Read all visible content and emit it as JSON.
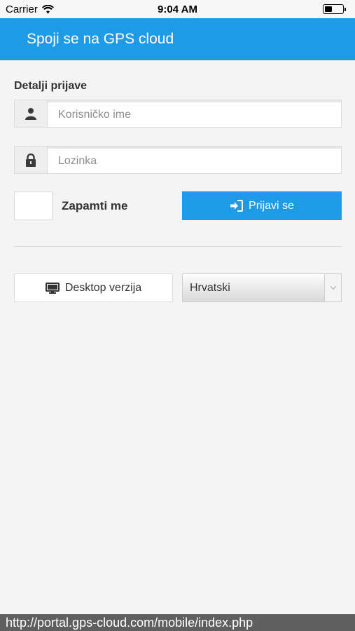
{
  "status_bar": {
    "carrier": "Carrier",
    "time": "9:04 AM"
  },
  "header": {
    "title": "Spoji se na GPS cloud"
  },
  "login": {
    "section_title": "Detalji prijave",
    "username_placeholder": "Korisničko ime",
    "password_placeholder": "Lozinka",
    "remember_label": "Zapamti me",
    "login_button": "Prijavi se"
  },
  "footer": {
    "desktop_button": "Desktop verzija",
    "language_selected": "Hrvatski"
  },
  "url": "http://portal.gps-cloud.com/mobile/index.php",
  "colors": {
    "accent": "#1e9be6",
    "background": "#f4f4f4"
  },
  "icons": [
    "wifi-icon",
    "battery-icon",
    "user-icon",
    "lock-icon",
    "sign-in-icon",
    "monitor-icon",
    "chevron-down-icon"
  ]
}
